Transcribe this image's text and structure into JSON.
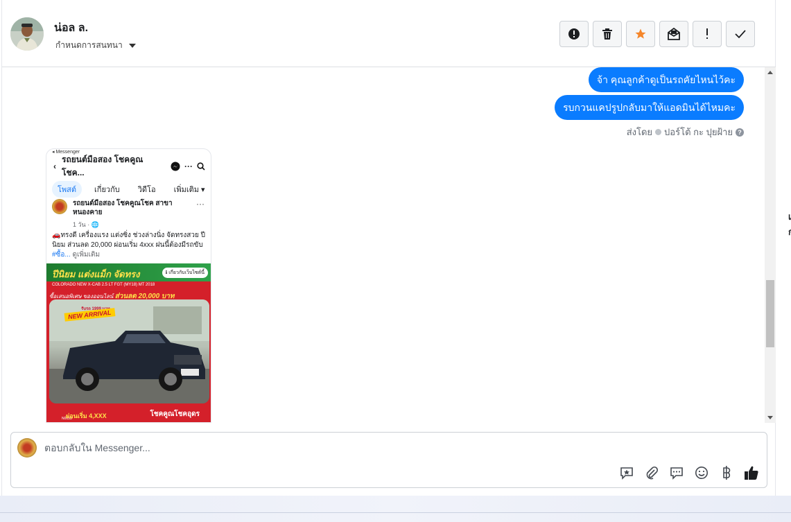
{
  "header": {
    "contact_name": "น่อล ล.",
    "assign_label": "กำหนดการสนทนา"
  },
  "toolbar": {
    "buttons": [
      {
        "name": "report",
        "icon": "exclamation-circle-icon"
      },
      {
        "name": "delete",
        "icon": "trash-icon"
      },
      {
        "name": "star",
        "icon": "star-icon",
        "color": "#f5862a"
      },
      {
        "name": "mark-unread",
        "icon": "envelope-open-icon"
      },
      {
        "name": "follow-up",
        "icon": "exclamation-icon"
      },
      {
        "name": "done",
        "icon": "checkmark-icon"
      }
    ]
  },
  "messages": {
    "outgoing": [
      "จ้า คุณลูกค้าดูเป็นรถคัยไหนไว้คะ",
      "รบกวนแคปรูปกลับมาให้แอดมินได้ไหมคะ"
    ],
    "sent_by_prefix": "ส่งโดย",
    "sent_by_name": "ปอร์โต้ กะ ปุยฝ้าย"
  },
  "screenshot": {
    "status_label": "◂ Messenger",
    "page_title": "รถยนต์มือสอง โชคคูณโชค...",
    "tabs": [
      "โพสต์",
      "เกี่ยวกับ",
      "วิดีโอ",
      "เพิ่มเติม ▾"
    ],
    "post_author": "รถยนต์มือสอง โชคคูณโชค สาขา หนองคาย",
    "post_time": "1 วัน · 🌐",
    "post_text": "🚗ทรงดี เครื่องแรง แต่งซิ่ง ช่วงล่างนิ่ง จัดทรงสวย ปี นิยม ส่วนลด 20,000 ผ่อนเริ่ม 4xxx ฝนนี้ต้องมีรถขับ ",
    "post_tag": "#ซื้อ...",
    "post_more": " ดูเพิ่มเติม",
    "ad": {
      "headline": "ปีนิยม แต่งแม็ก จัดทรง",
      "about_label": "ℹ เกี่ยวกับเว็บไซต์นี้",
      "model_line": "COLORADO NEW X-CAB 2.5 LT FGT (MY18) MT 2018",
      "offer_prefix": "ซื้อเสนอพิเศษ ของออนไลน์ ",
      "offer_value": "ส่วนลด 20,000 บาท",
      "promo_small": "รับรถ 1999 บาท",
      "new_arrival": "NEW ARRIVAL",
      "code": "N0033",
      "price": "ผ่อนเริ่ม 4,XXX",
      "brand": "โชคคูณโชคอุดร"
    }
  },
  "reply": {
    "placeholder": "ตอบกลับใน Messenger..."
  },
  "reply_icons": [
    "saved-reply-icon",
    "attachment-icon",
    "chat-bubbles-icon",
    "emoji-icon",
    "baht-icon",
    "thumbs-up-icon"
  ],
  "right_edge": {
    "glyph_top": "เ",
    "glyph_bottom": "ก"
  },
  "colors": {
    "outgoing_bubble": "#0a7cff",
    "star_accent": "#f5862a"
  }
}
